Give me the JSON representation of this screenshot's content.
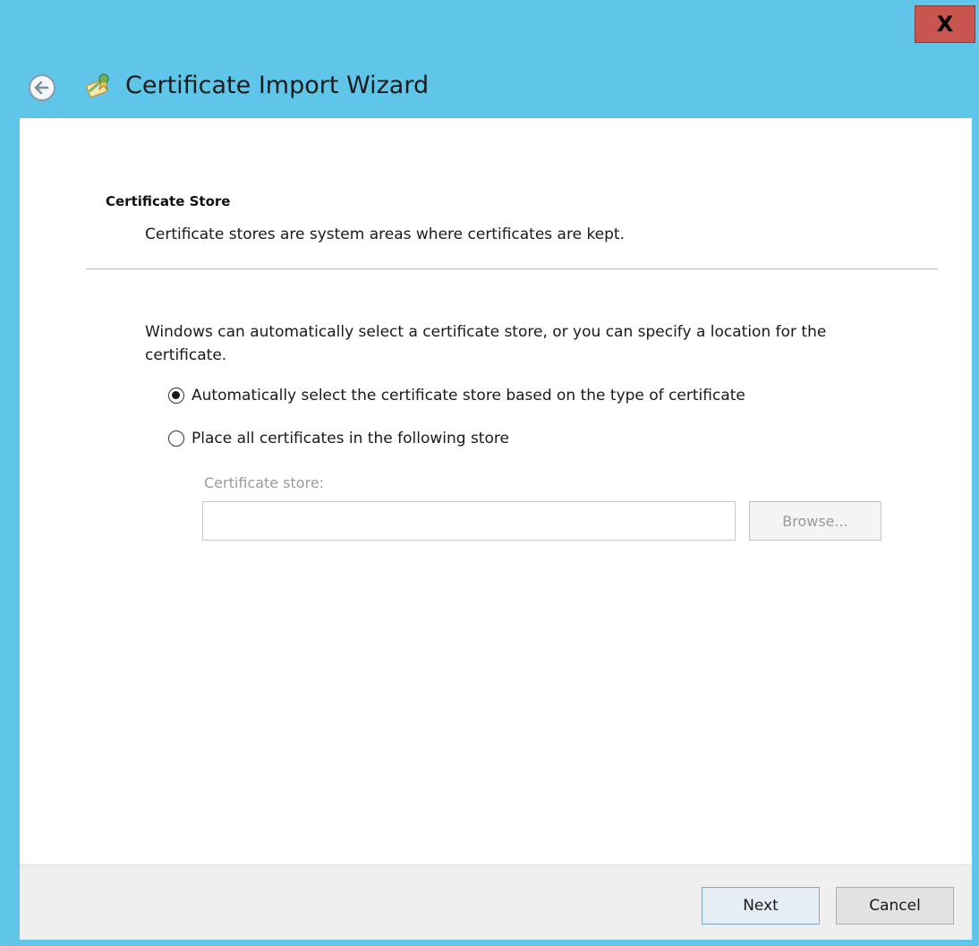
{
  "window": {
    "title": "Certificate Import Wizard",
    "close_label": "X",
    "colors": {
      "frame": "#5fc6ea",
      "close": "#c9564e"
    }
  },
  "header": {
    "back_icon": "back-arrow-icon",
    "app_icon": "certificate-icon"
  },
  "page": {
    "section_title": "Certificate Store",
    "section_desc": "Certificate stores are system areas where certificates are kept.",
    "intro": "Windows can automatically select a certificate store, or you can specify a location for the certificate.",
    "options": [
      {
        "label": "Automatically select the certificate store based on the type of certificate",
        "selected": true
      },
      {
        "label": "Place all certificates in the following store",
        "selected": false
      }
    ],
    "store": {
      "label": "Certificate store:",
      "value": "",
      "browse_label": "Browse..."
    }
  },
  "footer": {
    "next_label": "Next",
    "cancel_label": "Cancel"
  }
}
